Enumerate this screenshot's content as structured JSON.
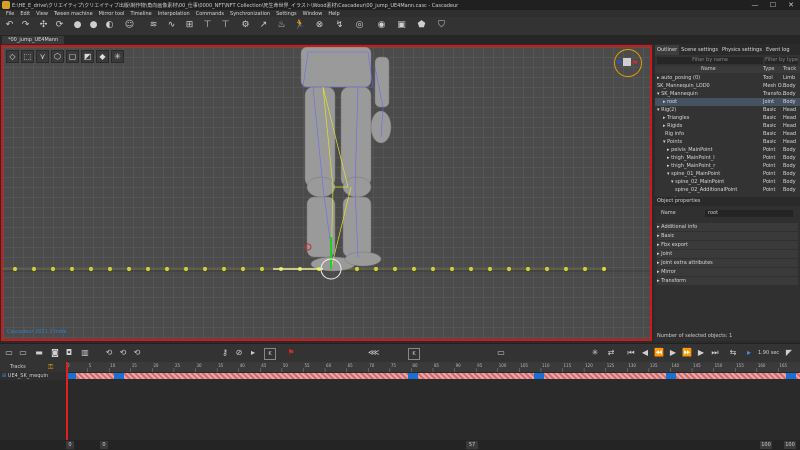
{
  "window": {
    "title": "E:\\HE_E_drive\\クリエイティブ\\クリエイティブ出版\\制作物\\角向画像素材\\00_仕事\\0000_NFT\\NFT Collection\\死生命世界_イラスト\\Wood素材\\Cascadeur\\00_jump_UE4Mann.casc - Cascadeur",
    "controls": [
      "—",
      "☐",
      "✕"
    ]
  },
  "menu": [
    "File",
    "Edit",
    "View",
    "Tween machine",
    "Mirror tool",
    "Timeline",
    "Interpolation",
    "Commands",
    "Synchronization",
    "Settings",
    "Window",
    "Help"
  ],
  "doc_tab": "*00_jump_UE4Mann",
  "viewport": {
    "label": "Cascadeur 2021.3 Indie",
    "tools": [
      "◇",
      "⬚",
      "⋎",
      "⬡",
      "▢",
      "◩",
      "◆",
      "✳"
    ]
  },
  "right_panel": {
    "tabs": [
      "Outliner",
      "Scene settings",
      "Physics settings",
      "Event log"
    ],
    "filter_placeholder": "Filter by name",
    "filter2_placeholder": "Filter by type",
    "columns": {
      "name": "Name",
      "type": "Type",
      "track": "Track"
    },
    "rows": [
      {
        "name": "▸ auto_posing (0)",
        "type": "Tool",
        "track": "Limb"
      },
      {
        "name": "SK_Mannequin_LOD0",
        "type": "Mesh O...",
        "track": "Body"
      },
      {
        "name": "▾ SK_Mannequin",
        "type": "Transfo...",
        "track": "Body"
      },
      {
        "name": "▸ root",
        "type": "Joint",
        "track": "Body"
      },
      {
        "name": "▾ Rig(2)",
        "type": "Basic",
        "track": "Head"
      },
      {
        "name": "▸ Triangles",
        "type": "Basic",
        "track": "Head"
      },
      {
        "name": "▸ Rigids",
        "type": "Basic",
        "track": "Head"
      },
      {
        "name": "Rig info",
        "type": "Basic",
        "track": "Head"
      },
      {
        "name": "▾ Points",
        "type": "Basic",
        "track": "Head"
      },
      {
        "name": "▸ pelvis_MainPoint",
        "type": "Point",
        "track": "Body"
      },
      {
        "name": "▸ thigh_MainPoint_l",
        "type": "Point",
        "track": "Body"
      },
      {
        "name": "▸ thigh_MainPoint_r",
        "type": "Point",
        "track": "Body"
      },
      {
        "name": "▾ spine_01_MainPoint",
        "type": "Point",
        "track": "Body"
      },
      {
        "name": "▾ spine_02_MainPoint",
        "type": "Point",
        "track": "Body"
      },
      {
        "name": "spine_02_AdditionalPoint",
        "type": "Point",
        "track": "Body"
      },
      {
        "name": "▸ ...",
        "type": "",
        "track": ""
      }
    ],
    "object_properties": {
      "title": "Object properties",
      "name_label": "Name",
      "name_value": "root",
      "sections": [
        "Additional info",
        "Basic",
        "Fbx export",
        "Joint",
        "Joint extra attributes",
        "Mirror",
        "Transform"
      ],
      "selected_count": "Number of selected objects: 1"
    }
  },
  "timeline": {
    "fps": "1.90 sec",
    "frame_hint": "K",
    "tracks_label": "Tracks",
    "track_name": "UE4_SK_mequin",
    "ruler_ticks": [
      "0",
      "5",
      "10",
      "15",
      "20",
      "25",
      "30",
      "35",
      "40",
      "45",
      "50",
      "55",
      "60",
      "65",
      "70",
      "75",
      "80",
      "85",
      "90",
      "95",
      "100",
      "105",
      "110",
      "115",
      "120",
      "125",
      "130",
      "135",
      "140",
      "145",
      "150",
      "155",
      "160",
      "165"
    ],
    "key_blocks": [
      0,
      48,
      342,
      468,
      600,
      720
    ]
  },
  "status": {
    "start": "0",
    "start2": "0",
    "current": "57",
    "end": "100",
    "end2": "100"
  },
  "colors": {
    "viewport_border": "#d01818",
    "key_blue": "#1c6fd1",
    "selection_highlight": "#465261",
    "gizmo_circle": "#e0a000",
    "rig_points": "#e0e030"
  }
}
